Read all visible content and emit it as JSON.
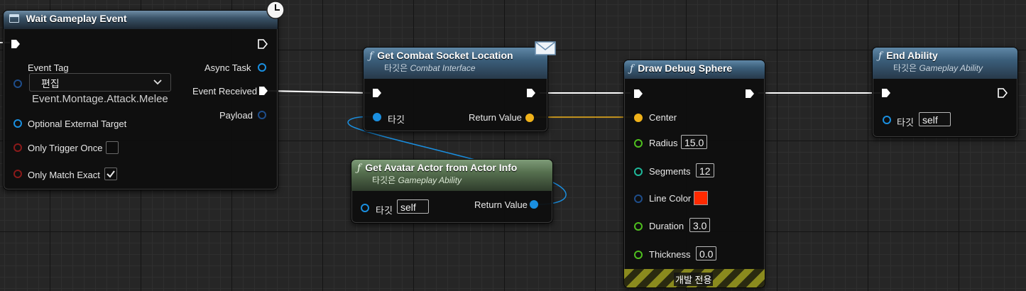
{
  "nodes": {
    "wait_gameplay_event": {
      "title": "Wait Gameplay Event",
      "pins": {
        "event_tag": "Event Tag",
        "dropdown_label": "편집",
        "tag_value": "Event.Montage.Attack.Melee",
        "optional_external_target": "Optional External Target",
        "only_trigger_once": "Only Trigger Once",
        "only_match_exact": "Only Match Exact",
        "async_task": "Async Task",
        "event_received": "Event Received",
        "payload": "Payload"
      },
      "only_trigger_once_checked": false,
      "only_match_exact_checked": true
    },
    "get_combat_socket_location": {
      "title": "Get Combat Socket Location",
      "subtitle_prefix": "타깃은",
      "subtitle_target": "Combat Interface",
      "target_label": "타깃",
      "return_value": "Return Value"
    },
    "get_avatar_actor": {
      "title": "Get Avatar Actor from Actor Info",
      "subtitle_prefix": "타깃은",
      "subtitle_target": "Gameplay Ability",
      "target_label": "타깃",
      "target_value": "self",
      "return_value": "Return Value"
    },
    "draw_debug_sphere": {
      "title": "Draw Debug Sphere",
      "center": "Center",
      "radius": "Radius",
      "radius_value": "15.0",
      "segments": "Segments",
      "segments_value": "12",
      "line_color": "Line Color",
      "line_color_value": "#ff2a00",
      "duration": "Duration",
      "duration_value": "3.0",
      "thickness": "Thickness",
      "thickness_value": "0.0",
      "dev_only": "개발 전용"
    },
    "end_ability": {
      "title": "End Ability",
      "subtitle_prefix": "타깃은",
      "subtitle_target": "Gameplay Ability",
      "target_label": "타깃",
      "target_value": "self"
    }
  },
  "icons": [
    "clock-icon",
    "envelope-icon",
    "function-icon",
    "event-node-icon",
    "chevron-down-icon",
    "checkmark-icon"
  ],
  "colors": {
    "exec_wire": "#ffffff",
    "object_pin": "#1a8fe0",
    "vector_pin": "#f0b21a",
    "float_pin": "#4fbf1f",
    "int_pin": "#1fb89a",
    "struct_pin": "#1e4d8a",
    "bool_pin": "#8a1a1a"
  }
}
